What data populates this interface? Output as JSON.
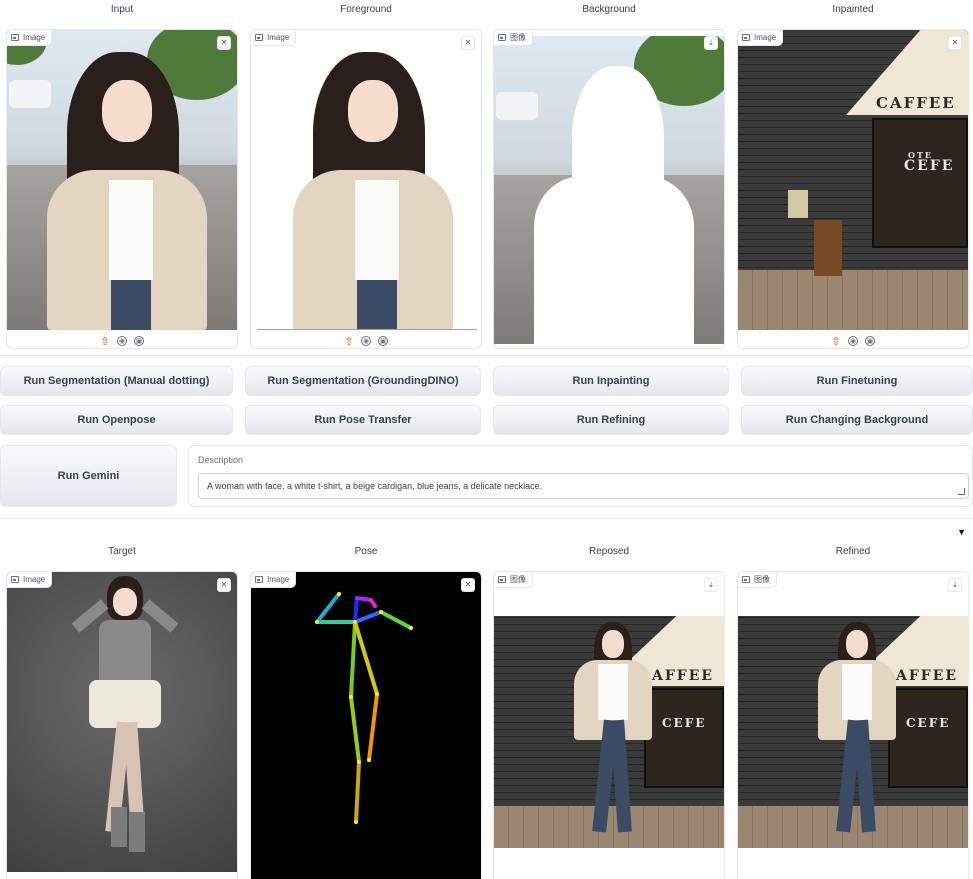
{
  "top_row": {
    "labels": [
      "Input",
      "Foreground",
      "Background",
      "Inpainted"
    ],
    "badges": [
      "Image",
      "Image",
      "图像",
      "Image"
    ],
    "corner_icons": [
      "close-icon",
      "close-icon",
      "download-icon",
      "close-icon"
    ]
  },
  "buttons": {
    "seg_manual": "Run Segmentation (Manual dotting)",
    "seg_dino": "Run Segmentation (GroundingDINO)",
    "inpainting": "Run Inpainting",
    "finetuning": "Run Finetuning",
    "openpose": "Run Openpose",
    "pose_transfer": "Run Pose Transfer",
    "refining": "Run Refining",
    "changing_bg": "Run Changing Background",
    "gemini": "Run Gemini"
  },
  "description": {
    "label": "Description",
    "value": "A woman with face, a white t-shirt, a beige cardigan, blue jeans, a delicate necklace."
  },
  "bottom_row": {
    "labels": [
      "Target",
      "Pose",
      "Reposed",
      "Refined"
    ],
    "badges": [
      "Image",
      "Image",
      "图像",
      "图像"
    ],
    "corner_icons": [
      "close-icon",
      "close-icon",
      "download-icon",
      "download-icon"
    ]
  },
  "sign": {
    "caffee": "CAFFEE",
    "cefe": "CEFE",
    "ote": "OTE",
    "affee": "AFFEE"
  },
  "toolbar_icons": [
    "upload-icon",
    "webcam-icon",
    "clipboard-icon"
  ],
  "colors": {
    "accent": "#f97316",
    "border": "#e5e7eb"
  }
}
